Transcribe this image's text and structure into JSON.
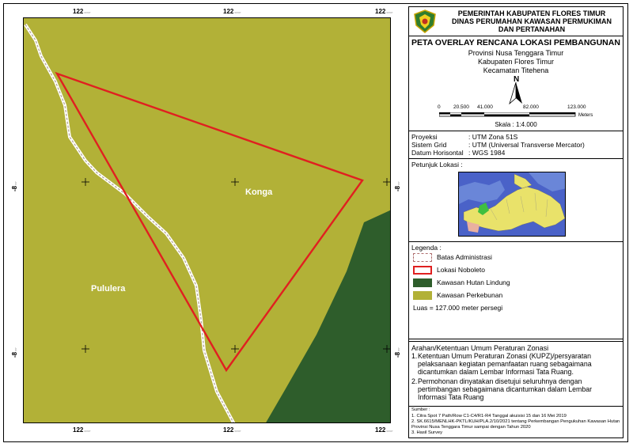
{
  "map": {
    "x_ticks_top": [
      "122",
      "122",
      "122"
    ],
    "x_ticks_bottom": [
      "122",
      "122",
      "122"
    ],
    "y_ticks_left": [
      "-8",
      "-8"
    ],
    "y_ticks_right": [
      "-8",
      "-8"
    ],
    "labels": {
      "konga": "Konga",
      "pululera": "Pululera"
    },
    "colors": {
      "perkebunan": "#b2b137",
      "hutan_lindung": "#2e5d2b",
      "lokasi": "#e02020",
      "batas": "#ffffff"
    }
  },
  "header": {
    "line1": "PEMERINTAH KABUPATEN FLORES TIMUR",
    "line2": "DINAS PERUMAHAN KAWASAN PERMUKIMAN",
    "line3": "DAN PERTANAHAN"
  },
  "title": {
    "main": "PETA OVERLAY RENCANA LOKASI PEMBANGUNAN",
    "province": "Provinsi Nusa Tenggara Timur",
    "regency": "Kabupaten Flores Timur",
    "district": "Kecamatan Titehena",
    "north": "N",
    "scalebar": [
      "0",
      "20.500",
      "41.000",
      "82.000",
      "123.000"
    ],
    "scalebar_unit": "Meters",
    "scale": "Skala : 1:4.000"
  },
  "projection": {
    "proyeksi_k": "Proyeksi",
    "proyeksi_v": ": UTM Zona 51S",
    "grid_k": "Sistem Grid",
    "grid_v": ": UTM (Universal Transverse Mercator)",
    "datum_k": "Datum Horisontal",
    "datum_v": ": WGS 1984"
  },
  "location": {
    "title": "Petunjuk Lokasi :"
  },
  "legend": {
    "title": "Legenda :",
    "items": [
      "Batas Administrasi",
      "Lokasi Noboleto",
      "Kawasan Hutan Lindung",
      "Kawasan Perkebunan"
    ],
    "luas": "Luas = 127.000 meter persegi"
  },
  "arahan": {
    "title": "Arahan/Ketentuan Umum Peraturan Zonasi",
    "item1_n": "1.",
    "item1": "Ketentuan Umum Peraturan Zonasi (KUPZ)/persyaratan pelaksanaan kegiatan pemanfaatan ruang sebagaimana dicantumkan dalam Lembar Informasi Tata Ruang.",
    "item2_n": "2.",
    "item2": "Permohonan dinyatakan disetujui seluruhnya dengan pertimbangan sebagaimana dicantumkan dalam Lembar Informasi Tata Ruang"
  },
  "sumber": {
    "title": "Sumber :",
    "s1": "1. Citra Spot 7 Path/Row C1-C4/R1-R4 Tanggal akuisisi 15 dan 16 Mei 2019",
    "s2": "2. SK.6615/MENLHK-PKTL/KUH/PLA.2/10/2021 tentang Perkembangan Pengukuhan Kawasan Hutan Provinsi Nusa Tenggara Timur sampai dengan Tahun 2020",
    "s3": "3. Hasil Survey"
  }
}
